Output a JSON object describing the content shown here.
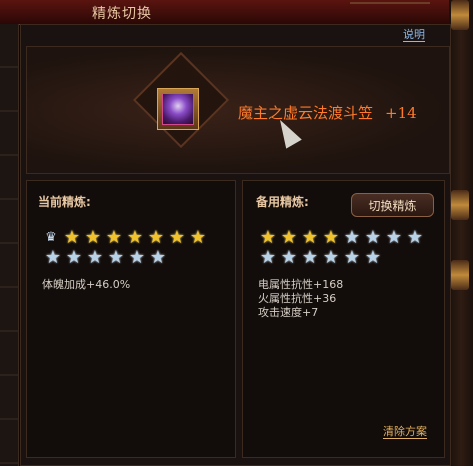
{
  "window": {
    "title": "精炼切换",
    "help_label": "说明"
  },
  "item": {
    "name": "魔主之虚云法渡斗笠",
    "level": "+14",
    "icon": "helmet-icon",
    "name_color": "#ff7a2a"
  },
  "current": {
    "title": "当前精炼:",
    "stars_lit": 7,
    "stars_total": 13,
    "stats": [
      "体魄加成+46.0%"
    ]
  },
  "backup": {
    "title": "备用精炼:",
    "switch_label": "切换精炼",
    "stars_lit": 4,
    "stars_total": 14,
    "stats": [
      "电属性抗性+168",
      "火属性抗性+36",
      "攻击速度+7"
    ],
    "clear_label": "清除方案"
  },
  "colors": {
    "gold_star": "#f2c22a",
    "silver_star": "#b8d2e8",
    "link_blue": "#8db8e8",
    "link_gold": "#e2b062"
  }
}
